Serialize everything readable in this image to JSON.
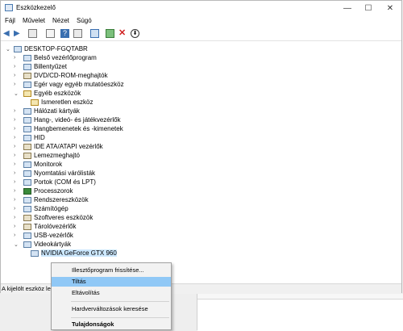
{
  "window": {
    "title": "Eszközkezelő",
    "controls": [
      "—",
      "☐",
      "✕"
    ]
  },
  "menu": [
    "Fájl",
    "Művelet",
    "Nézet",
    "Súgó"
  ],
  "tree": {
    "root": "DESKTOP-FGQTABR",
    "categories": [
      "Belső vezérlőprogram",
      "Billentyűzet",
      "DVD/CD-ROM-meghajtók",
      "Egér vagy egyéb mutatóeszköz",
      "Egyéb eszközök",
      "Ismeretlen eszköz",
      "Hálózati kártyák",
      "Hang-, videó- és játékvezérlők",
      "Hangbemenetek és -kimenetek",
      "HID",
      "IDE ATA/ATAPI vezérlők",
      "Lemezmeghajtó",
      "Monitorok",
      "Nyomtatási várólisták",
      "Portok (COM és LPT)",
      "Processzorok",
      "Rendszereszközök",
      "Számítógép",
      "Szoftveres eszközök",
      "Tárolóvezérlők",
      "USB-vezérlők",
      "Videokártyák",
      "NVIDIA GeForce GTX 960"
    ]
  },
  "status": "A kijelölt eszköz leti",
  "context_menu": {
    "items": [
      "Illesztőprogram frissítése...",
      "Tiltás",
      "Eltávolítás",
      "Hardverváltozások keresése",
      "Tulajdonságok"
    ]
  },
  "colors": {
    "highlight": "#90c8f6",
    "selection": "#cce8ff"
  }
}
